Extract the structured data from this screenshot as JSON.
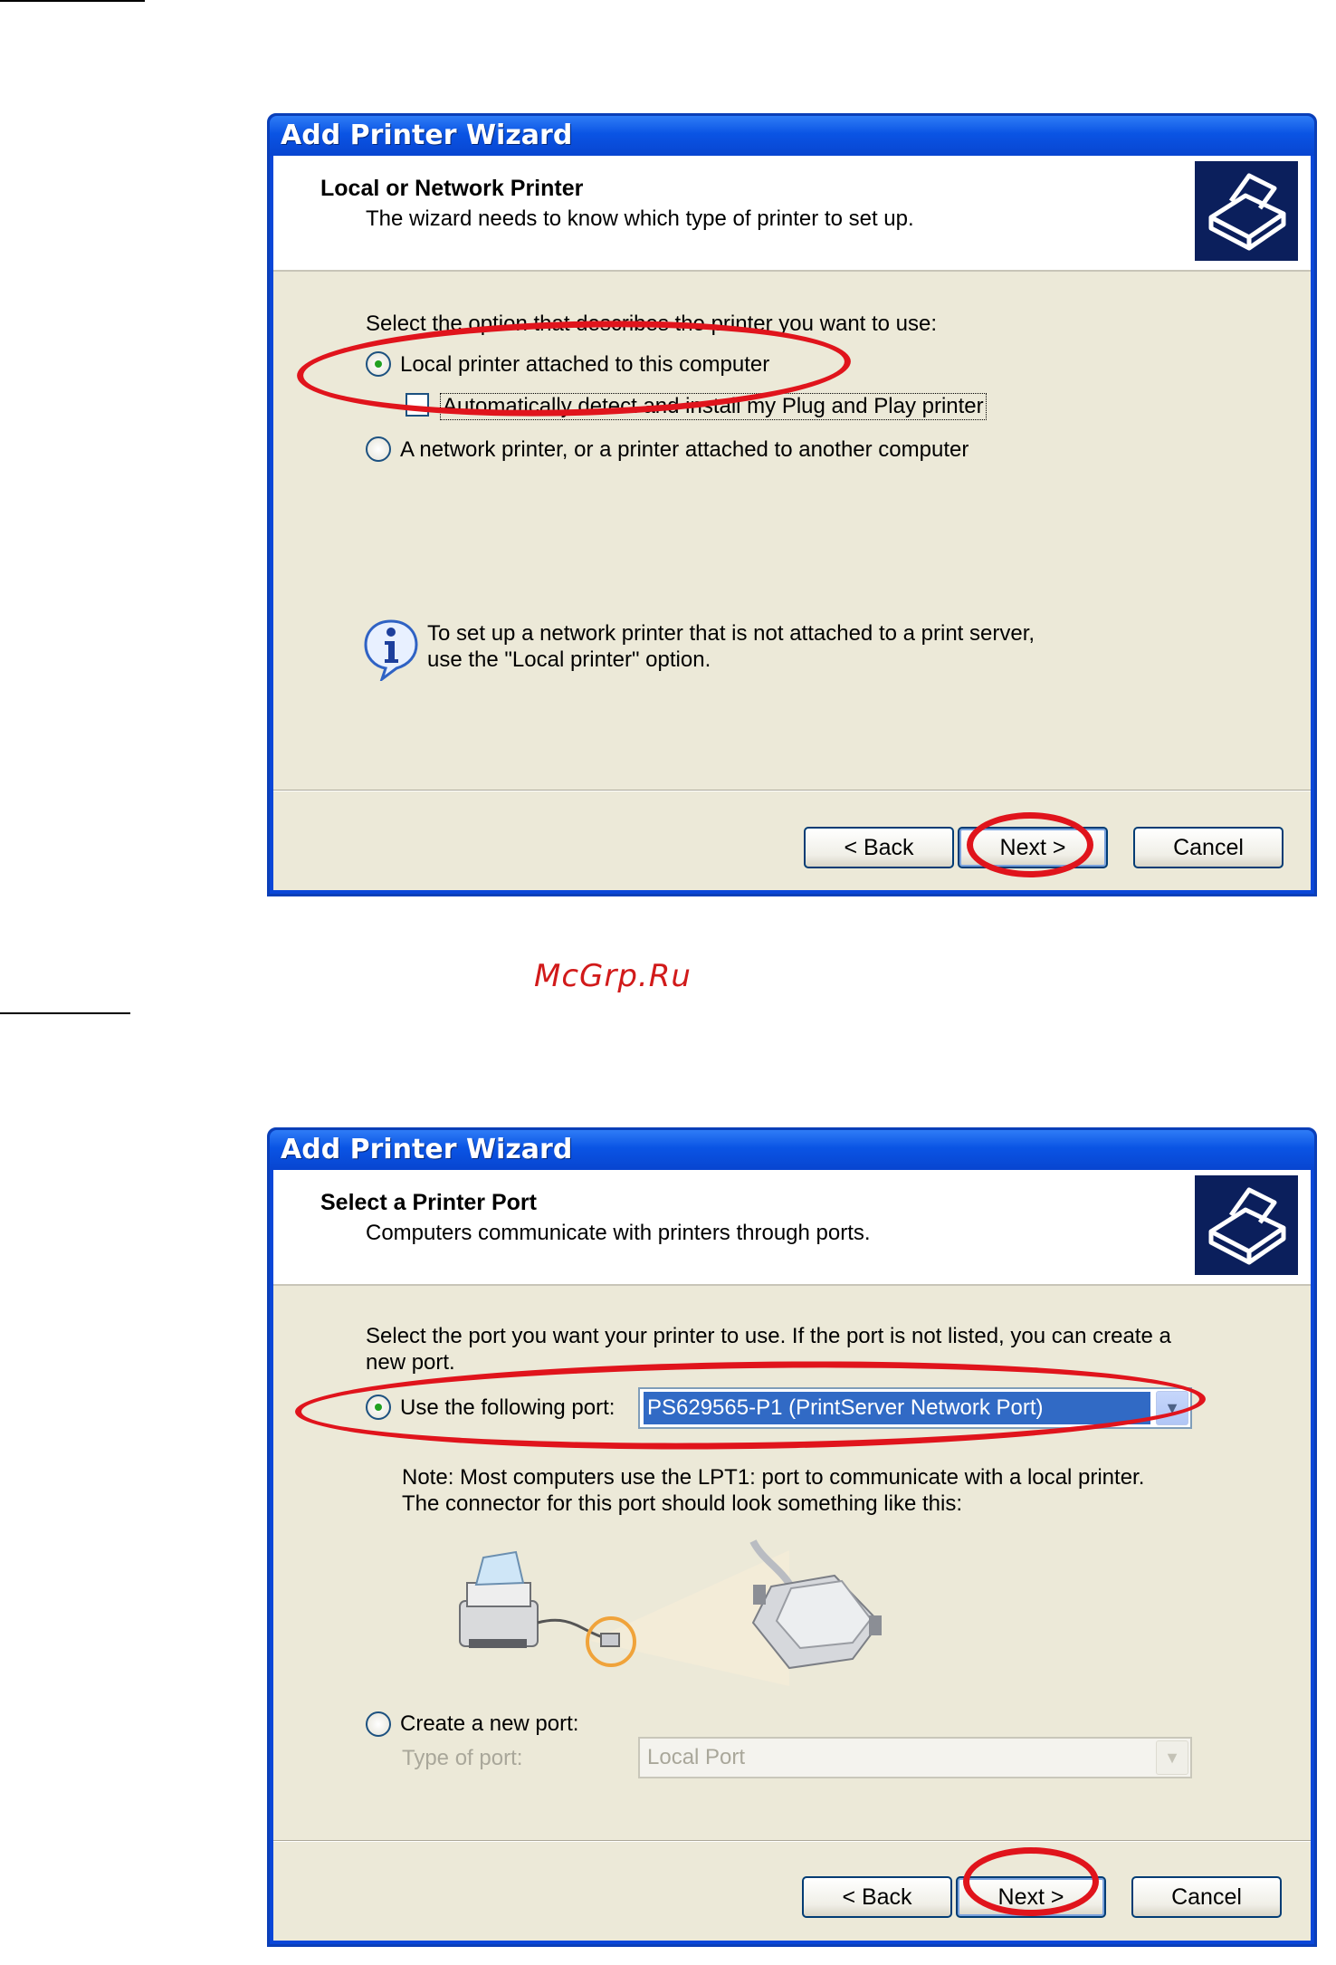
{
  "watermark": "McGrp.Ru",
  "dialog1": {
    "title": "Add Printer Wizard",
    "header_title": "Local or Network Printer",
    "header_subtitle": "The wizard needs to know which type of printer to set up.",
    "prompt": "Select the option that describes the printer you want to use:",
    "option_local": "Local printer attached to this computer",
    "option_local_selected": true,
    "checkbox_autodetect": "Automatically detect and install my Plug and Play printer",
    "checkbox_autodetect_checked": false,
    "option_network": "A network printer, or a printer attached to another computer",
    "info_line1": "To set up a network printer that is not attached to a print server,",
    "info_line2": "use the \"Local printer\" option.",
    "back_label": "< Back",
    "next_label": "Next >",
    "cancel_label": "Cancel"
  },
  "dialog2": {
    "title": "Add Printer Wizard",
    "header_title": "Select a Printer Port",
    "header_subtitle": "Computers communicate with printers through ports.",
    "prompt_line1": "Select the port you want your printer to use.  If the port is not listed, you can create a",
    "prompt_line2": "new port.",
    "option_use_port": "Use the following port:",
    "option_use_port_selected": true,
    "port_value": "PS629565-P1 (PrintServer Network Port)",
    "note_line1": "Note: Most computers use the LPT1: port to communicate with a local printer.",
    "note_line2": "The connector for this port should look something like this:",
    "option_create_port": "Create a new port:",
    "type_of_port_label": "Type of port:",
    "type_of_port_value": "Local Port",
    "back_label": "< Back",
    "next_label": "Next >",
    "cancel_label": "Cancel"
  },
  "colors": {
    "title_bar": "#0a54e4",
    "dialog_face": "#ece9d8",
    "highlight_ellipse": "#e0141c",
    "selection": "#316ac5"
  }
}
